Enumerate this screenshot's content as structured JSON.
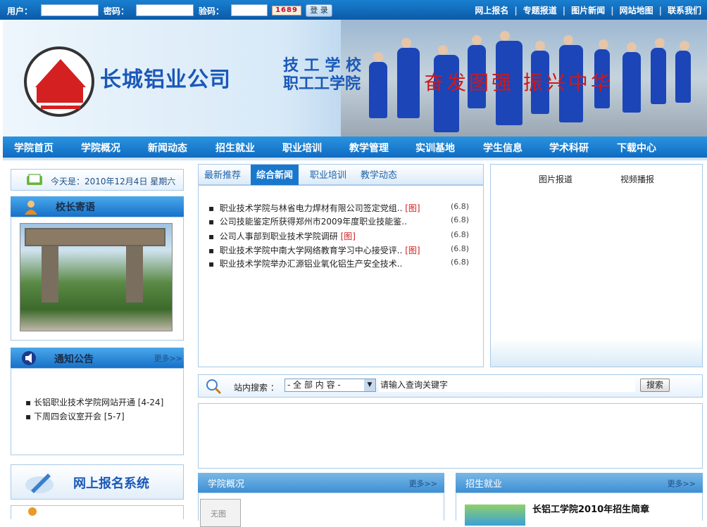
{
  "topbar": {
    "user_label": "用户：",
    "password_label": "密码：",
    "captcha_label": "验码：",
    "captcha_value": "1689",
    "login_label": "登 录",
    "links": [
      "网上报名",
      "专题报道",
      "图片新闻",
      "网站地图",
      "联系我们"
    ]
  },
  "banner": {
    "company": "长城铝业公司",
    "sub_line1": "技 工 学 校",
    "sub_line2": "职工工学院",
    "slogan": "奋发图强  振兴中华"
  },
  "nav": [
    "学院首页",
    "学院概况",
    "新闻动态",
    "招生就业",
    "职业培训",
    "教学管理",
    "实训基地",
    "学生信息",
    "学术科研",
    "下载中心"
  ],
  "today": "今天是：2010年12月4日 星期六",
  "principal": {
    "title": "校长寄语"
  },
  "notice": {
    "title": "通知公告",
    "more": "更多>>",
    "items": [
      "长铝职业技术学院网站开通 [4-24]",
      "下周四会议室开会 [5-7]"
    ]
  },
  "register": {
    "title": "网上报名系统"
  },
  "news_tabs": [
    "最新推荐",
    "综合新闻",
    "职业培训",
    "教学动态"
  ],
  "news_active": 1,
  "news": [
    {
      "title": "职业技术学院与林省电力焊材有限公司签定党组..",
      "tag": "[图]",
      "date": "(6.8)"
    },
    {
      "title": "公司技能鉴定所获得郑州市2009年度职业技能鉴..",
      "tag": "",
      "date": "(6.8)"
    },
    {
      "title": "公司人事部到职业技术学院调研",
      "tag": "[图]",
      "date": "(6.8)"
    },
    {
      "title": "职业技术学院中南大学网络教育学习中心接受评..",
      "tag": "[图]",
      "date": "(6.8)"
    },
    {
      "title": "职业技术学院举办汇源铝业氧化铝生产安全技术..",
      "tag": "",
      "date": "(6.8)"
    }
  ],
  "media_tabs": [
    "图片报道",
    "视频播报"
  ],
  "search": {
    "label": "站内搜索 ：",
    "scope": "- 全 部 内 容 -",
    "placeholder": "请输入查询关键字",
    "button": "搜索"
  },
  "college": {
    "title": "学院概况",
    "more": "更多>>",
    "noimg": "无图"
  },
  "admission": {
    "title": "招生就业",
    "more": "更多>>",
    "headline": "长铝工学院2010年招生简章"
  },
  "colors": {
    "nav": "#1a78cc",
    "red": "#d42020"
  }
}
